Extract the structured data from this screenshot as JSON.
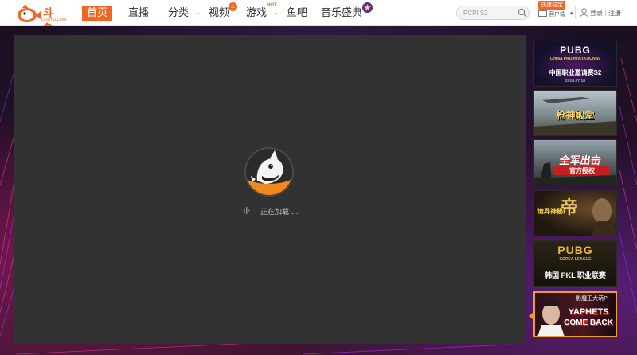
{
  "brand": {
    "logo_text": "斗鱼",
    "logo_sub": "DOUYU.COM",
    "accent": "#f26522"
  },
  "nav": {
    "home": "首页",
    "items": [
      {
        "label": "直播"
      },
      {
        "label": "分类"
      },
      {
        "label": "视频"
      },
      {
        "label": "游戏"
      },
      {
        "label": "鱼吧"
      },
      {
        "label": "音乐盛典"
      }
    ],
    "hot_badge": "HOT"
  },
  "search": {
    "placeholder": "PCPI S2"
  },
  "client": {
    "speed_tag": "快速稳定",
    "label": "客户端"
  },
  "account": {
    "login": "登录",
    "separator": "|",
    "register": "注册"
  },
  "player": {
    "loading_text": "正在加载 ..."
  },
  "side_rail": {
    "items": [
      {
        "title": "PUBG",
        "subtitle": "CHINA PRO INVITATIONAL",
        "caption": "中国职业邀请赛S2",
        "date": "2018.07.18"
      },
      {
        "title": "枪神殿堂",
        "subtitle": "",
        "caption": "",
        "date": ""
      },
      {
        "title": "全军出击",
        "subtitle": "",
        "caption": "官方授权",
        "date": ""
      },
      {
        "title": "帝",
        "subtitle": "",
        "caption": "诡异神秘",
        "date": ""
      },
      {
        "title": "PUBG",
        "subtitle": "KOREA LEAGUE",
        "caption": "韩国 PKL 职业联赛",
        "date": ""
      },
      {
        "title": "YAPHETS",
        "subtitle": "COME BACK",
        "caption": "影魔王大萌P",
        "date": ""
      }
    ],
    "active_index": 5
  }
}
